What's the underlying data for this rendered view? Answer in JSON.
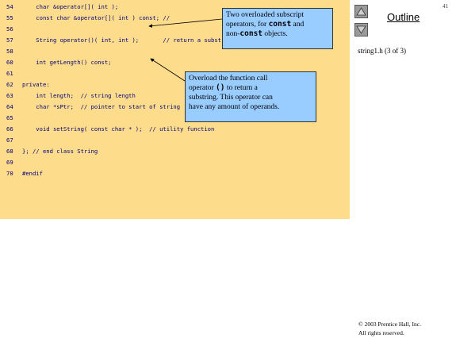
{
  "slide_number": "41",
  "outline": {
    "title": "Outline",
    "caption": "string1.h (3 of 3)"
  },
  "code": [
    {
      "num": "54",
      "text": "    char &operator[]( int );"
    },
    {
      "num": "55",
      "text": "    const char &operator[]( int ) const; //"
    },
    {
      "num": "56",
      "text": ""
    },
    {
      "num": "57",
      "text": "    String operator()( int, int );       // return a substring"
    },
    {
      "num": "58",
      "text": ""
    },
    {
      "num": "60",
      "text": "    int getLength() const;"
    },
    {
      "num": "61",
      "text": ""
    },
    {
      "num": "62",
      "text": "private:"
    },
    {
      "num": "63",
      "text": "    int length;  // string length"
    },
    {
      "num": "64",
      "text": "    char *sPtr;  // pointer to start of string"
    },
    {
      "num": "65",
      "text": ""
    },
    {
      "num": "66",
      "text": "    void setString( const char * );  // utility function"
    },
    {
      "num": "67",
      "text": ""
    },
    {
      "num": "68",
      "text": "}; // end class String"
    },
    {
      "num": "69",
      "text": ""
    },
    {
      "num": "70",
      "text": "#endif"
    }
  ],
  "callout1": {
    "t1": "Two overloaded subscript",
    "t2": "operators, for ",
    "code1": "const",
    "t3": " and",
    "t4": "non-",
    "code2": "const",
    "t5": " objects."
  },
  "callout2": {
    "t1": "Overload the function call",
    "t2": "operator ",
    "code1": "()",
    "t3": " to return a",
    "t4": "substring. This operator can",
    "t5": "have any amount of operands."
  },
  "copyright": {
    "line1": "© 2003 Prentice Hall, Inc.",
    "line2": "All rights reserved."
  },
  "colors": {
    "code_bg": "#fddc8c",
    "callout_bg": "#99ccff",
    "code_text": "#00007a",
    "nav_button": "#9a9a9a"
  },
  "icons": {
    "nav_up": "triangle-up-icon",
    "nav_down": "triangle-down-icon"
  }
}
